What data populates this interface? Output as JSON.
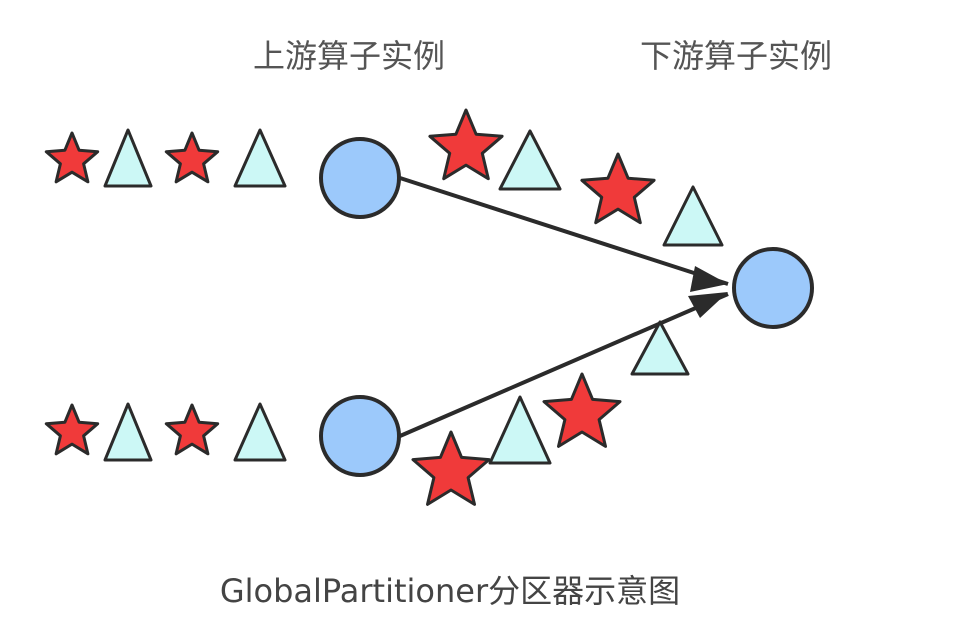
{
  "labels": {
    "upstream": "上游算子实例",
    "downstream": "下游算子实例",
    "caption": "GlobalPartitioner分区器示意图"
  },
  "colors": {
    "node_fill": "#9cc9fb",
    "star_fill": "#f03a3a",
    "triangle_fill": "#ccf8f6",
    "stroke": "#2b2b2b",
    "text": "#555555"
  },
  "icons": {
    "star": "star-icon",
    "triangle": "triangle-icon",
    "node": "operator-instance-circle"
  }
}
